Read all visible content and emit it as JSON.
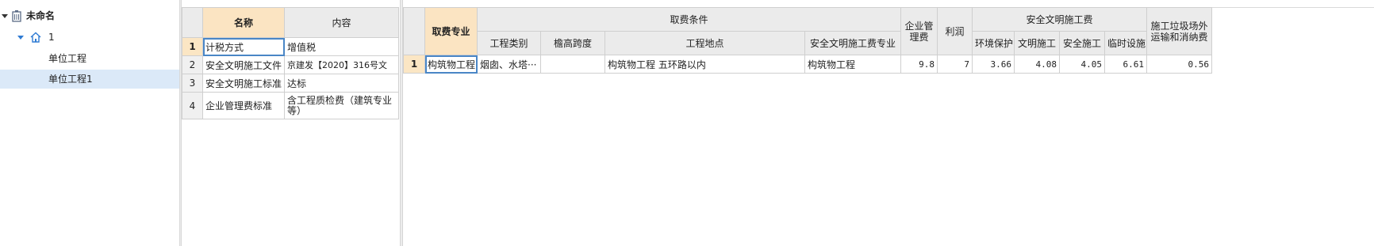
{
  "tree": {
    "root_label": "未命名",
    "project_label": "1",
    "units": [
      "单位工程",
      "单位工程1"
    ]
  },
  "param_table": {
    "headers": {
      "name": "名称",
      "content": "内容"
    },
    "rows": [
      {
        "no": "1",
        "name": "计税方式",
        "content": "增值税"
      },
      {
        "no": "2",
        "name": "安全文明施工文件",
        "content": "京建发【2020】316号文"
      },
      {
        "no": "3",
        "name": "安全文明施工标准",
        "content": "达标"
      },
      {
        "no": "4",
        "name": "企业管理费标准",
        "content": "含工程质检费（建筑专业等）"
      }
    ]
  },
  "fee_table": {
    "headers": {
      "specialty": "取费专业",
      "conditions": "取费条件",
      "project_type": "工程类别",
      "eave_span": "檐高跨度",
      "location": "工程地点",
      "safety_specialty": "安全文明施工费专业",
      "mgmt_fee": "企业管理费",
      "profit": "利润",
      "safety_fee": "安全文明施工费",
      "env": "环境保护",
      "civil": "文明施工",
      "safe": "安全施工",
      "temp": "临时设施",
      "waste": "施工垃圾场外运输和消纳费"
    },
    "rows": [
      {
        "no": "1",
        "specialty": "构筑物工程",
        "project_type": "烟囱、水塔···",
        "eave_span": "",
        "location": "构筑物工程 五环路以内",
        "safety_specialty": "构筑物工程",
        "mgmt_fee": "9.8",
        "profit": "7",
        "env": "3.66",
        "civil": "4.08",
        "safe": "4.05",
        "temp": "6.61",
        "waste": "0.56"
      }
    ]
  }
}
